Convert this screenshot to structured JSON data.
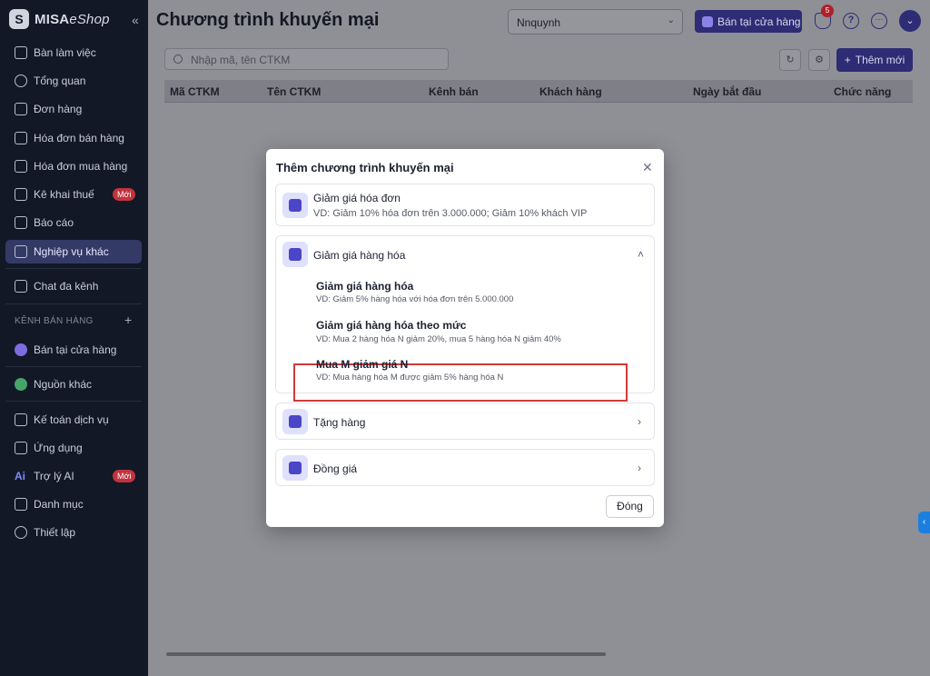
{
  "brand": {
    "name_bold": "MISA",
    "name_italic": "eShop",
    "collapse_glyph": "«"
  },
  "sidebar": {
    "items": [
      {
        "label": "Bàn làm việc",
        "icon": "desk-icon"
      },
      {
        "label": "Tổng quan",
        "icon": "compass-icon"
      },
      {
        "label": "Đơn hàng",
        "icon": "order-icon"
      },
      {
        "label": "Hóa đơn bán hàng",
        "icon": "invoice-icon"
      },
      {
        "label": "Hóa đơn mua hàng",
        "icon": "purchase-invoice-icon"
      },
      {
        "label": "Kê khai thuế",
        "icon": "tax-icon",
        "badge": "Mới"
      },
      {
        "label": "Báo cáo",
        "icon": "chart-icon"
      },
      {
        "label": "Nghiệp vụ khác",
        "icon": "list-icon",
        "active": true
      },
      {
        "label": "Chat đa kênh",
        "icon": "chat-icon"
      }
    ],
    "channels_label": "KÊNH BÁN HÀNG",
    "channels_add": "+",
    "channels": [
      {
        "label": "Bán tại cửa hàng",
        "icon": "store-icon"
      },
      {
        "label": "Nguồn khác",
        "icon": "source-icon"
      }
    ],
    "bottom_items": [
      {
        "label": "Kế toán dịch vụ",
        "icon": "accounting-icon"
      },
      {
        "label": "Ứng dụng",
        "icon": "apps-icon"
      },
      {
        "label": "Trợ lý AI",
        "icon": "ai-icon",
        "badge": "Mới",
        "glyph": "Ai"
      },
      {
        "label": "Danh mục",
        "icon": "catalog-icon"
      },
      {
        "label": "Thiết lập",
        "icon": "gear-icon"
      }
    ]
  },
  "header": {
    "title": "Chương trình khuyến mại",
    "user": "Nnquynh",
    "store_button": "Bán tại cửa hàng",
    "notification_count": "5",
    "help_glyph": "?",
    "more_glyph": "···"
  },
  "toolbar": {
    "search_placeholder": "Nhập mã, tên CTKM",
    "add_button": "Thêm mới",
    "add_glyph": "+",
    "refresh_glyph": "↻",
    "settings_glyph": "⚙"
  },
  "table": {
    "columns": [
      "Mã CTKM",
      "Tên CTKM",
      "Kênh bán",
      "Khách hàng",
      "Ngày bắt đầu",
      "Chức năng"
    ]
  },
  "modal": {
    "title": "Thêm chương trình khuyến mại",
    "close_glyph": "✕",
    "invoice": {
      "title": "Giảm giá hóa đơn",
      "desc": "VD: Giảm 10% hóa đơn trên 3.000.000; Giảm 10% khách VIP"
    },
    "goods": {
      "title": "Giảm giá hàng hóa",
      "chevron": "˄",
      "options": [
        {
          "title": "Giảm giá hàng hóa",
          "desc": "VD: Giảm 5% hàng hóa với hóa đơn trên 5.000.000"
        },
        {
          "title": "Giảm giá hàng hóa theo mức",
          "desc": "VD: Mua 2 hàng hóa N giảm 20%, mua 5 hàng hóa N giảm 40%"
        },
        {
          "title": "Mua M giảm giá N",
          "desc": "VD: Mua hàng hóa M được giảm 5% hàng hóa N"
        }
      ]
    },
    "gift": {
      "title": "Tặng hàng",
      "chevron": "›"
    },
    "same_price": {
      "title": "Đồng giá",
      "chevron": "›"
    },
    "close_button": "Đóng"
  },
  "colors": {
    "accent": "#2e2c74",
    "highlight": "#d23a3a",
    "active_nav": "#343a66"
  }
}
